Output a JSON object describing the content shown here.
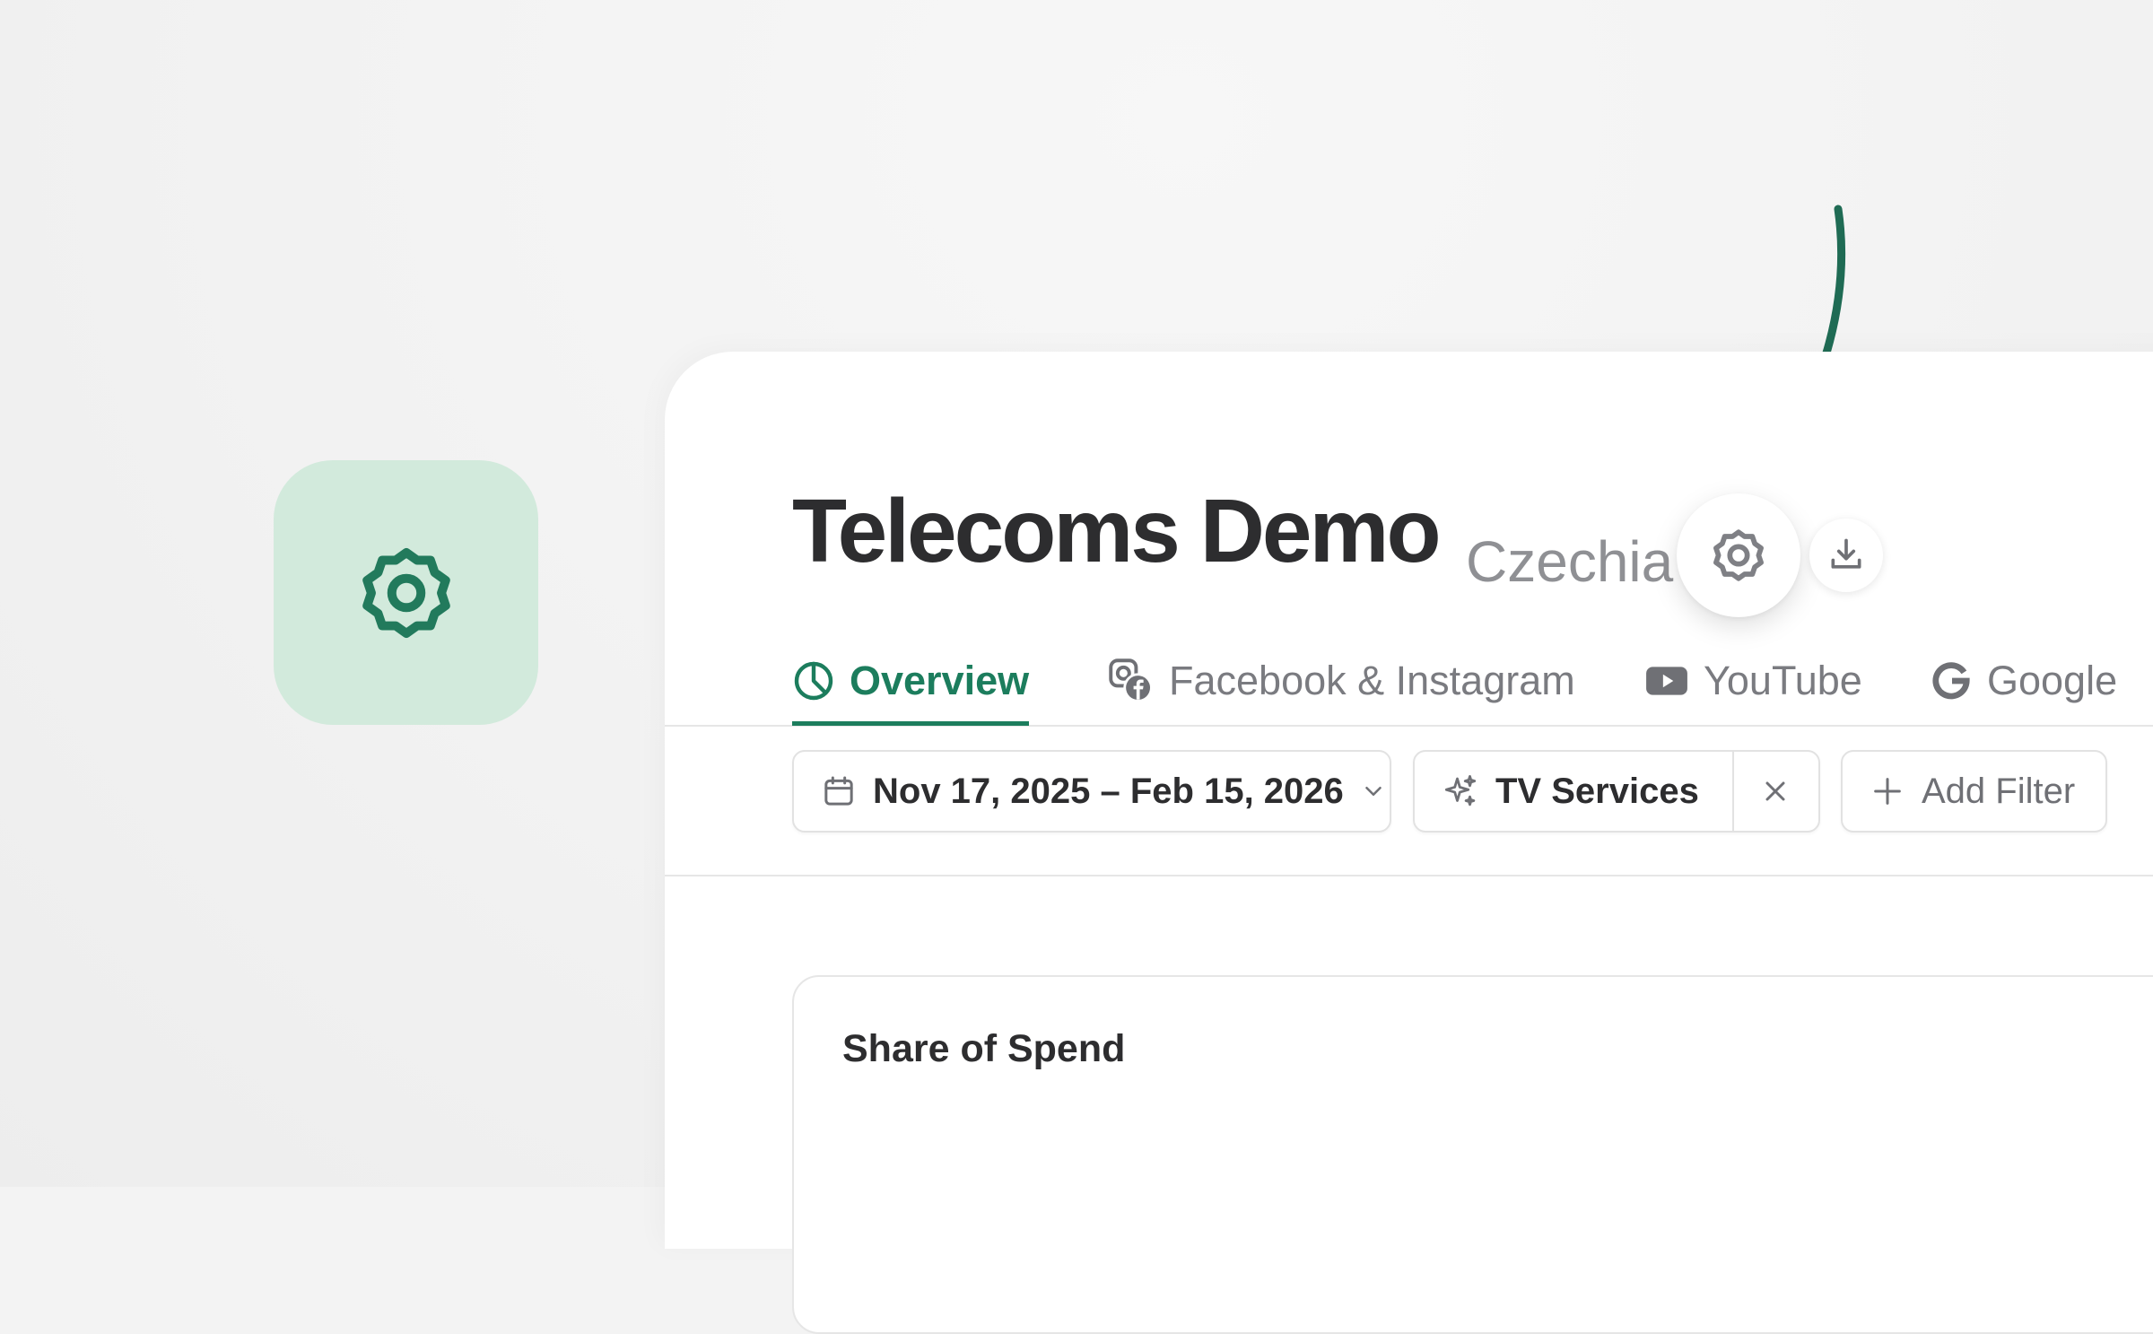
{
  "dashboard": {
    "title": "Telecoms Demo",
    "market": "Czechia"
  },
  "tabs": [
    {
      "label": "Overview",
      "icon": "pie-chart-icon",
      "active": true
    },
    {
      "label": "Facebook & Instagram",
      "icon": "facebook-instagram-icon",
      "active": false
    },
    {
      "label": "YouTube",
      "icon": "youtube-icon",
      "active": false
    },
    {
      "label": "Google",
      "icon": "google-icon",
      "active": false
    }
  ],
  "filters": {
    "date_range": "Nov 17, 2025 – Feb 15, 2026",
    "category": "TV Services",
    "add_label": "Add Filter"
  },
  "card": {
    "title": "Share of Spend"
  },
  "colors": {
    "accent": "#1c7d5d",
    "tile_bg": "#d2eadc",
    "arrow": "#1f6b54",
    "text": "#2d2d2f",
    "muted": "#8f9094"
  }
}
